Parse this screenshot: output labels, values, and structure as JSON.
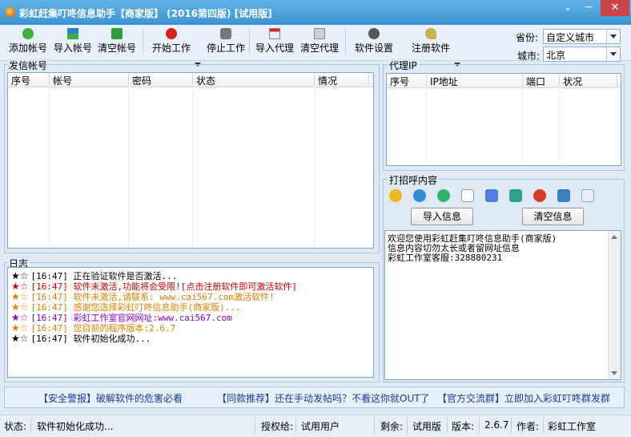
{
  "window": {
    "title": "彩虹赶集叮咚信息助手【商家版】 (2016第四版) [试用版]",
    "controls": {
      "menu": "⌄",
      "minimize": "─",
      "maximize": "☐",
      "close": "✕"
    }
  },
  "toolbar": {
    "add_account": "添加帐号",
    "import_account": "导入帐号",
    "clear_account": "清空帐号",
    "start_work": "开始工作",
    "stop_work": "停止工作",
    "import_proxy": "导入代理",
    "clear_proxy": "清空代理",
    "settings": "软件设置",
    "register": "注册软件",
    "province_label": "省份:",
    "province_value": "自定义城市",
    "city_label": "城市:",
    "city_value": "北京"
  },
  "accounts": {
    "title": "发信帐号",
    "columns": [
      "序号",
      "帐号",
      "密码",
      "状态",
      "情况"
    ]
  },
  "proxy": {
    "title": "代理IP",
    "columns": [
      "序号",
      "IP地址",
      "端口",
      "状况"
    ]
  },
  "greeting": {
    "title": "打招呼内容",
    "import_btn": "导入信息",
    "clear_btn": "清空信息",
    "lines": [
      "欢迎您使用彩虹赶集叮咚信息助手(商家版)",
      "信息内容切勿太长或者留网址信息",
      "彩虹工作室客服:328880231"
    ]
  },
  "log": {
    "title": "日志",
    "entries": [
      {
        "star": "★☆",
        "text": "[16:47] 正在验证软件是否激活...",
        "color": "#000000",
        "star_color": "#000000"
      },
      {
        "star": "★☆",
        "text": "[16:47] 软件未激活,功能将会受限![点击注册软件即可激活软件]",
        "color": "#d40000",
        "star_color": "#d40000"
      },
      {
        "star": "★☆",
        "text": "[16:47] 软件未激活,请联系: www.cai567.com激活软件!",
        "color": "#e08000",
        "star_color": "#e08000"
      },
      {
        "star": "★☆",
        "text": "[16:47] 感谢您选择彩虹叮咚信息助手(商家版)...",
        "color": "#e08000",
        "star_color": "#e08000"
      },
      {
        "star": "★☆",
        "text": "[16:47] 彩虹工作室官网网址:www.cai567.com",
        "color": "#8a00c8",
        "star_color": "#8a00c8"
      },
      {
        "star": "★☆",
        "text": "[16:47] 您目前的程序版本:2.6.7",
        "color": "#e08000",
        "star_color": "#e08000"
      },
      {
        "star": "★☆",
        "text": "[16:47] 软件初始化成功...",
        "color": "#000000",
        "star_color": "#000000"
      }
    ]
  },
  "banner": {
    "warning": "【安全警报】破解软件的危害必看",
    "recommend": "【同款推荐】还在手动发帖吗？不看这你就OUT了",
    "group": "【官方交流群】立即加入彩虹叮咚群发群"
  },
  "statusbar": {
    "status_label": "状态:",
    "status_value": "软件初始化成功...",
    "auth_label": "授权给:",
    "auth_value": "试用用户",
    "remain_label": "剩余:",
    "remain_value": "试用版",
    "version_label": "版本:",
    "version_value": "2.6.7",
    "author_label": "作者:",
    "author_value": "彩虹工作室"
  }
}
